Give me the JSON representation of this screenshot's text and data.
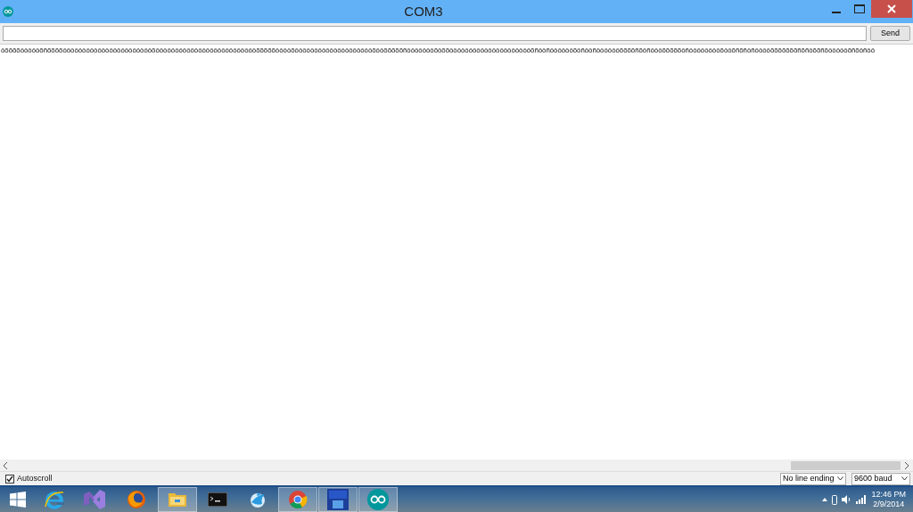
{
  "window": {
    "title": "COM3"
  },
  "send_button": "Send",
  "output_lines": [
    "ôõõõõôôôôôõñõõõõôôôôôôôôôôôôôôôôôôôôôôôõôôôôôôôôôôôôôôôôôôôôôôôôôôõõõõõôôôôõôôôôôôôôôôôôôôôôôôôôõôôõõõõõñôôôôôôôõôõõôôôôôôôôôôôôôôôôôôôôôõñôôñôôôôôôõôñôôñôôôôôôõõõõñõôñôôôõõõõõôñôôôôôôôôõôôõñõñôñôôôôõõõõõõõñõñôõõñõôôôôôõñõôñôô"
  ],
  "autoscroll": {
    "label": "Autoscroll",
    "checked": true
  },
  "line_ending": "No line ending",
  "baud": "9600 baud",
  "taskbar": [
    {
      "kind": "start",
      "open": false
    },
    {
      "kind": "ie",
      "open": false
    },
    {
      "kind": "vs",
      "open": false
    },
    {
      "kind": "firefox",
      "open": false
    },
    {
      "kind": "explorer",
      "open": true
    },
    {
      "kind": "cmd",
      "open": false
    },
    {
      "kind": "bird",
      "open": false
    },
    {
      "kind": "chrome",
      "open": true
    },
    {
      "kind": "devcpp",
      "open": true
    },
    {
      "kind": "arduino",
      "open": true
    }
  ],
  "clock": {
    "time": "12:46 PM",
    "date": "2/9/2014"
  }
}
